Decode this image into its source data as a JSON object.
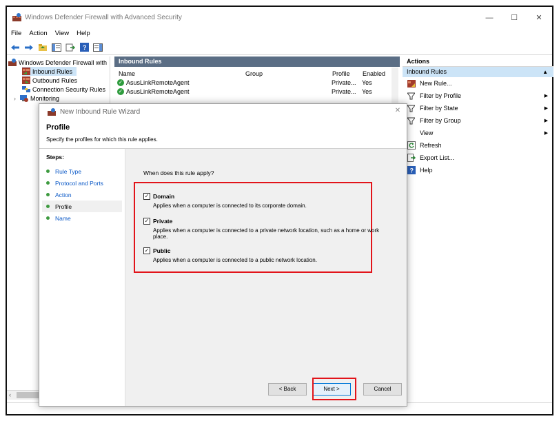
{
  "window": {
    "title": "Windows Defender Firewall with Advanced Security",
    "minimize": "—",
    "maximize": "☐",
    "close": "✕"
  },
  "menu": [
    "File",
    "Action",
    "View",
    "Help"
  ],
  "tree": {
    "root": "Windows Defender Firewall with",
    "items": [
      "Inbound Rules",
      "Outbound Rules",
      "Connection Security Rules",
      "Monitoring"
    ],
    "expand_glyph": "›"
  },
  "middle": {
    "header": "Inbound Rules",
    "columns": [
      "Name",
      "Group",
      "Profile",
      "Enabled"
    ],
    "rows": [
      {
        "name": "AsusLinkRemoteAgent",
        "profile": "Private...",
        "enabled": "Yes"
      },
      {
        "name": "AsusLinkRemoteAgent",
        "profile": "Private...",
        "enabled": "Yes"
      }
    ]
  },
  "actions": {
    "header": "Actions",
    "section": "Inbound Rules",
    "items": [
      {
        "label": "New Rule...",
        "icon": "new-rule-icon",
        "submenu": false
      },
      {
        "label": "Filter by Profile",
        "icon": "filter-icon",
        "submenu": true
      },
      {
        "label": "Filter by State",
        "icon": "filter-icon",
        "submenu": true
      },
      {
        "label": "Filter by Group",
        "icon": "filter-icon",
        "submenu": true
      },
      {
        "label": "View",
        "icon": "",
        "submenu": true
      },
      {
        "label": "Refresh",
        "icon": "refresh-icon",
        "submenu": false
      },
      {
        "label": "Export List...",
        "icon": "export-icon",
        "submenu": false
      },
      {
        "label": "Help",
        "icon": "help-icon",
        "submenu": false
      }
    ]
  },
  "wizard": {
    "title": "New Inbound Rule Wizard",
    "close": "✕",
    "heading": "Profile",
    "description": "Specify the profiles for which this rule applies.",
    "steps_title": "Steps:",
    "steps": [
      "Rule Type",
      "Protocol and Ports",
      "Action",
      "Profile",
      "Name"
    ],
    "current_step": "Profile",
    "question": "When does this rule apply?",
    "options": [
      {
        "label": "Domain",
        "checked": true,
        "description": "Applies when a computer is connected to its corporate domain."
      },
      {
        "label": "Private",
        "checked": true,
        "description": "Applies when a computer is connected to a private network location, such as a home or work place."
      },
      {
        "label": "Public",
        "checked": true,
        "description": "Applies when a computer is connected to a public network location."
      }
    ],
    "check_glyph": "✓",
    "buttons": {
      "back": "< Back",
      "next": "Next >",
      "cancel": "Cancel"
    }
  },
  "colors": {
    "highlight": "#e2141a",
    "header_bar": "#5b6e85",
    "selection": "#cce4f7",
    "step_link": "#0b59c7"
  }
}
